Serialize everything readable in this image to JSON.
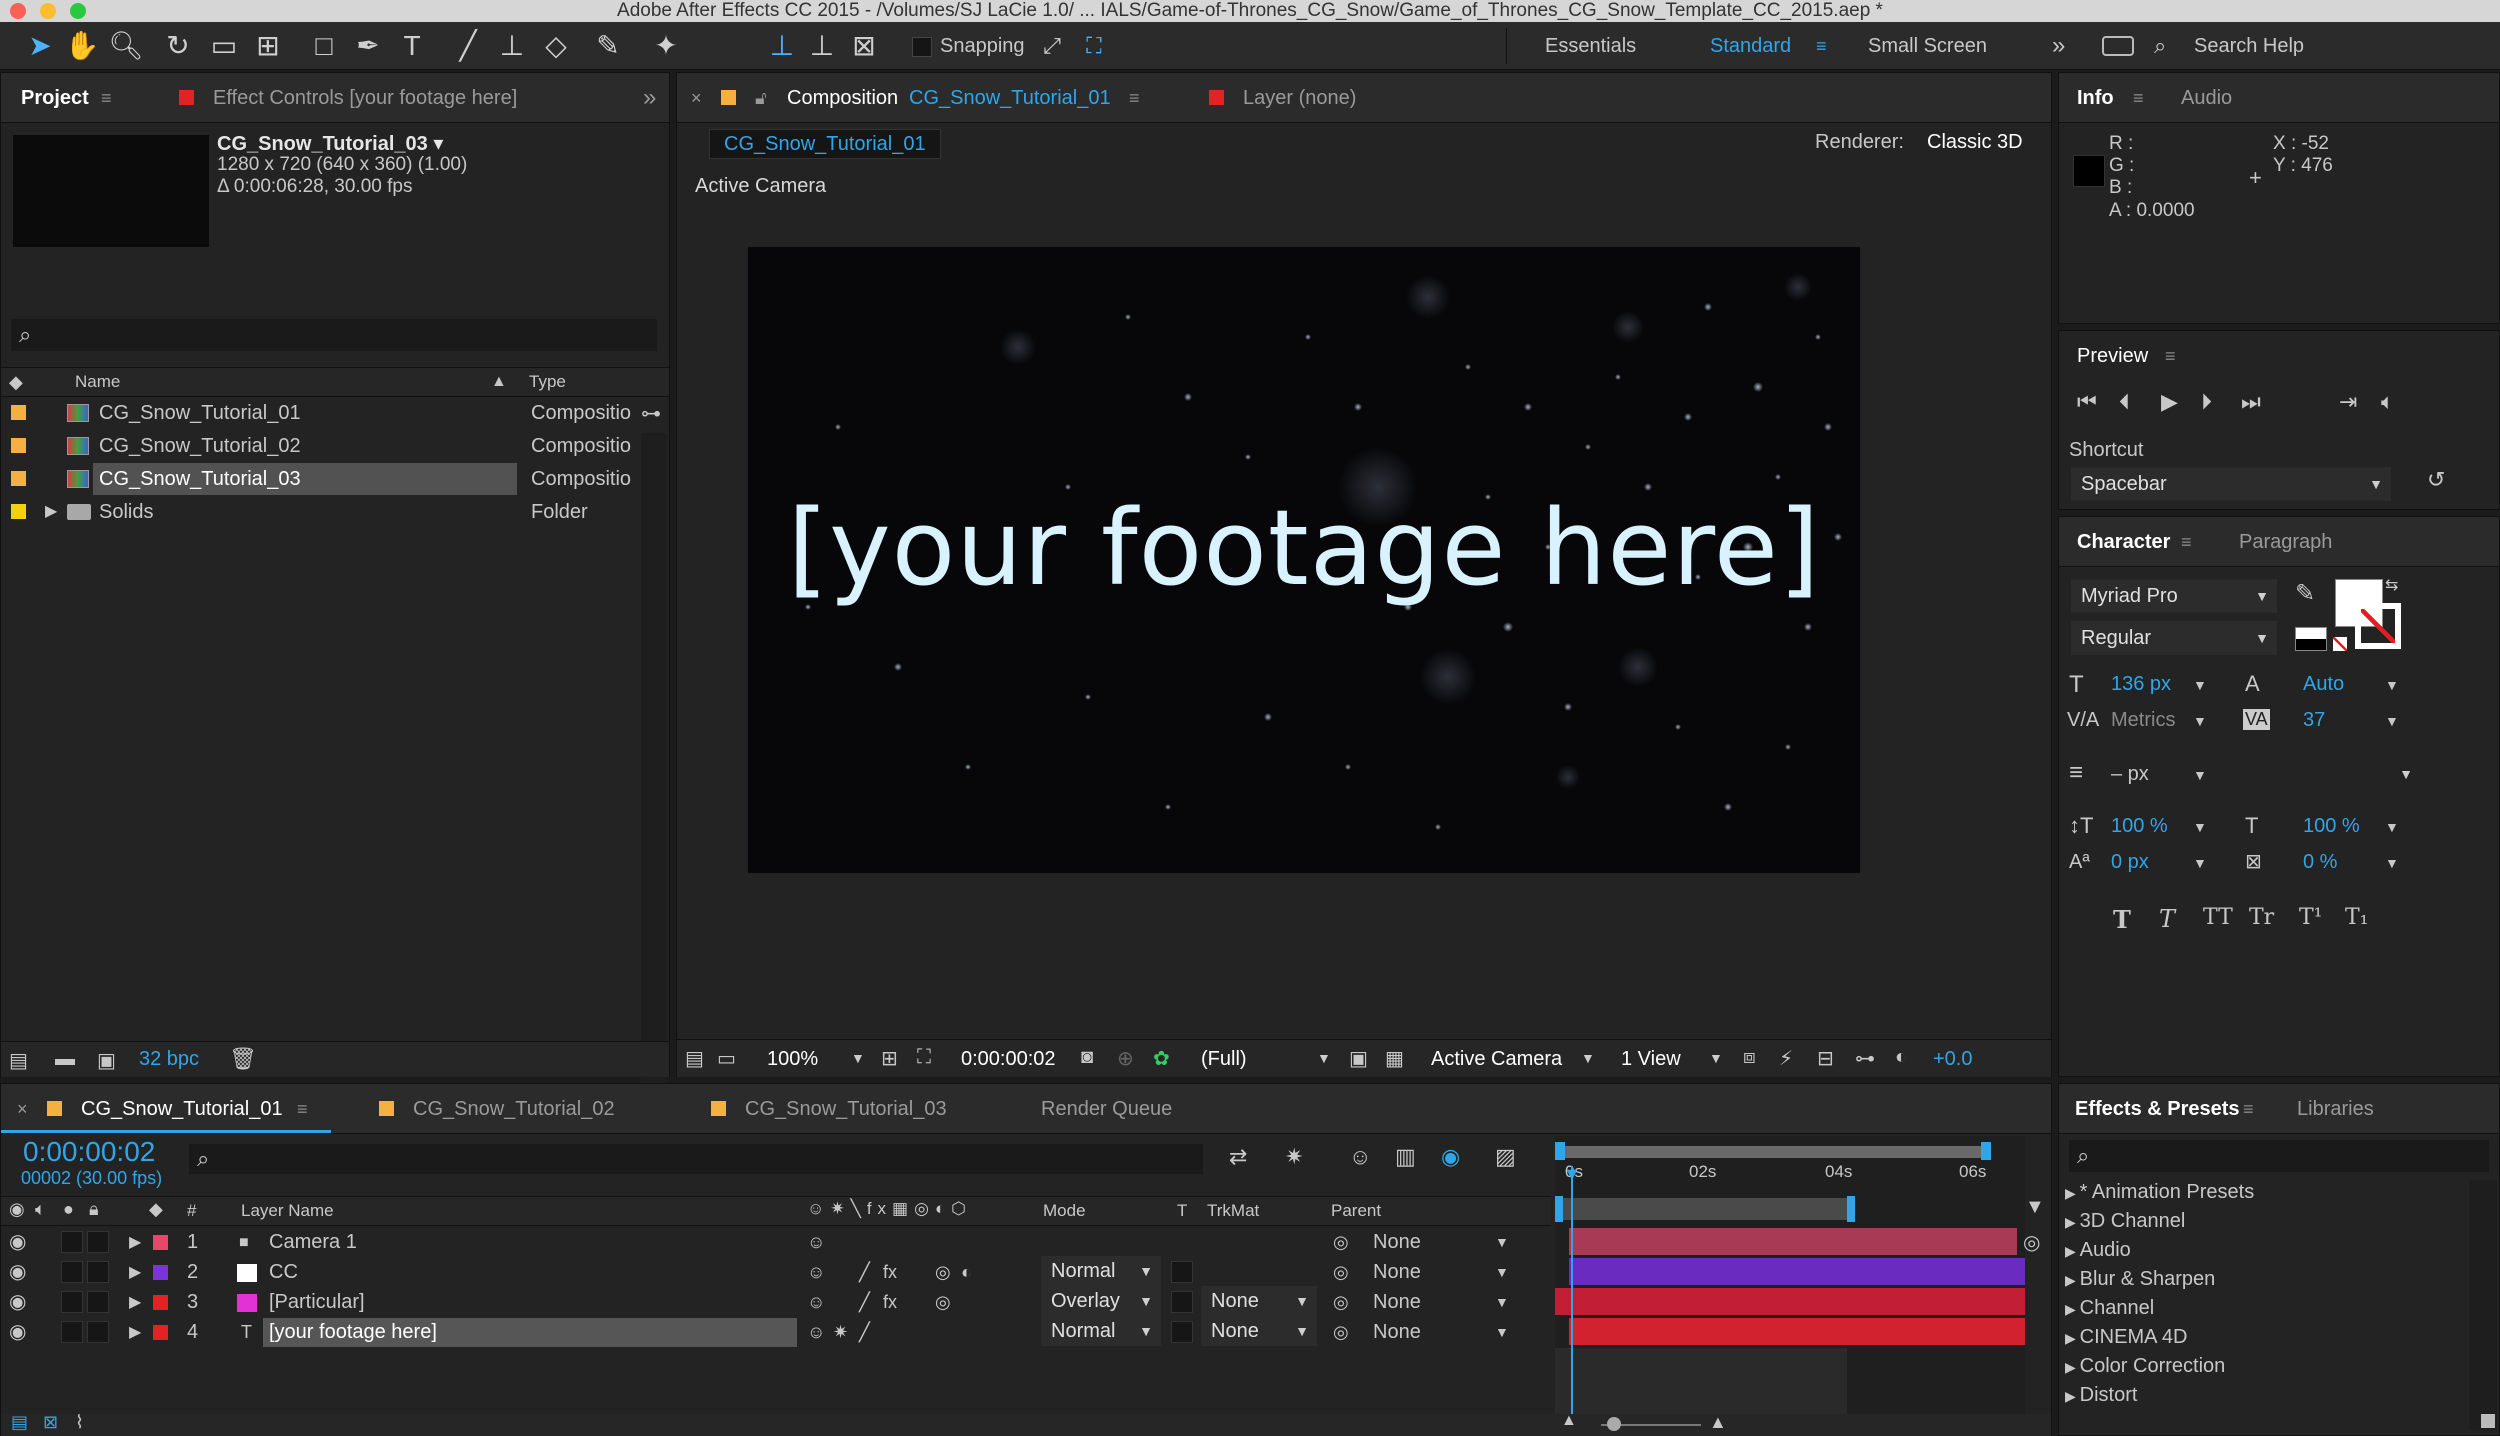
{
  "window_title": "Adobe After Effects CC 2015 - /Volumes/SJ LaCie 1.0/ ... IALS/Game-of-Thrones_CG_Snow/Game_of_Thrones_CG_Snow_Template_CC_2015.aep *",
  "toolbar": {
    "snapping_label": "Snapping",
    "workspaces": [
      "Essentials",
      "Standard",
      "Small Screen"
    ],
    "search_placeholder": "Search Help",
    "overflow": "»"
  },
  "project_panel": {
    "tab_project": "Project",
    "tab_effect_controls": "Effect Controls [your footage here]",
    "overflow": "»",
    "selected_name": "CG_Snow_Tutorial_03 ▾",
    "selected_dims": "1280 x 720  (640 x 360) (1.00)",
    "selected_duration": "Δ 0:00:06:28, 30.00 fps",
    "col_name": "Name",
    "col_type": "Type",
    "items": [
      {
        "name": "CG_Snow_Tutorial_01",
        "type": "Compositio",
        "color": "#f5b041"
      },
      {
        "name": "CG_Snow_Tutorial_02",
        "type": "Compositio",
        "color": "#f5b041"
      },
      {
        "name": "CG_Snow_Tutorial_03",
        "type": "Compositio",
        "color": "#f5b041"
      },
      {
        "name": "Solids",
        "type": "Folder",
        "color": "#f3d10b"
      }
    ],
    "bpc": "32 bpc"
  },
  "composition_panel": {
    "tab_prefix": "Composition",
    "tab_comp_name": "CG_Snow_Tutorial_01",
    "tab_layer": "Layer (none)",
    "comp_button": "CG_Snow_Tutorial_01",
    "renderer_label": "Renderer:",
    "renderer_value": "Classic 3D",
    "camera_label": "Active Camera",
    "canvas_text": "[your footage here]",
    "footer": {
      "zoom": "100%",
      "timecode": "0:00:00:02",
      "resolution": "(Full)",
      "camera": "Active Camera",
      "views": "1 View",
      "exposure": "+0.0"
    }
  },
  "info_panel": {
    "tab_info": "Info",
    "tab_audio": "Audio",
    "r": "R :",
    "g": "G :",
    "b": "B :",
    "a": "A :  0.0000",
    "x": "X : -52",
    "y": "Y : 476"
  },
  "preview_panel": {
    "title": "Preview",
    "shortcut_label": "Shortcut",
    "shortcut_value": "Spacebar"
  },
  "character_panel": {
    "tab_character": "Character",
    "tab_paragraph": "Paragraph",
    "font": "Myriad Pro",
    "style": "Regular",
    "size": "136 px",
    "leading": "Auto",
    "kerning": "Metrics",
    "tracking": "37",
    "stroke": "– px",
    "vscale": "100 %",
    "hscale": "100 %",
    "baseline": "0 px",
    "tsume": "0 %",
    "type_buttons": [
      "T",
      "T",
      "TT",
      "Tr",
      "T¹",
      "T₁"
    ]
  },
  "timeline": {
    "tabs": [
      "CG_Snow_Tutorial_01",
      "CG_Snow_Tutorial_02",
      "CG_Snow_Tutorial_03",
      "Render Queue"
    ],
    "timecode": "0:00:00:02",
    "frame": "00002 (30.00 fps)",
    "col_num": "#",
    "col_layer": "Layer Name",
    "col_mode": "Mode",
    "col_t": "T",
    "col_trkmat": "TrkMat",
    "col_parent": "Parent",
    "ruler": [
      "0s",
      "02s",
      "04s",
      "06s"
    ],
    "layers": [
      {
        "num": "1",
        "name": "Camera 1",
        "color": "#e8476a",
        "mode": "",
        "trkmat": "",
        "parent": "None",
        "bar": "#a83a56"
      },
      {
        "num": "2",
        "name": "CC",
        "color": "#7a35d8",
        "mode": "Normal",
        "trkmat": "",
        "parent": "None",
        "bar": "#6a2bc0"
      },
      {
        "num": "3",
        "name": "[Particular]",
        "color": "#e232d6",
        "mode": "Overlay",
        "trkmat": "None",
        "parent": "None",
        "bar": "#c21f37"
      },
      {
        "num": "4",
        "name": "[your footage here]",
        "color": "#e32323",
        "mode": "Normal",
        "trkmat": "None",
        "parent": "None",
        "bar": "#d3222f"
      }
    ]
  },
  "effects_panel": {
    "tab_effects": "Effects & Presets",
    "tab_libraries": "Libraries",
    "items": [
      "* Animation Presets",
      "3D Channel",
      "Audio",
      "Blur & Sharpen",
      "Channel",
      "CINEMA 4D",
      "Color Correction",
      "Distort"
    ]
  }
}
